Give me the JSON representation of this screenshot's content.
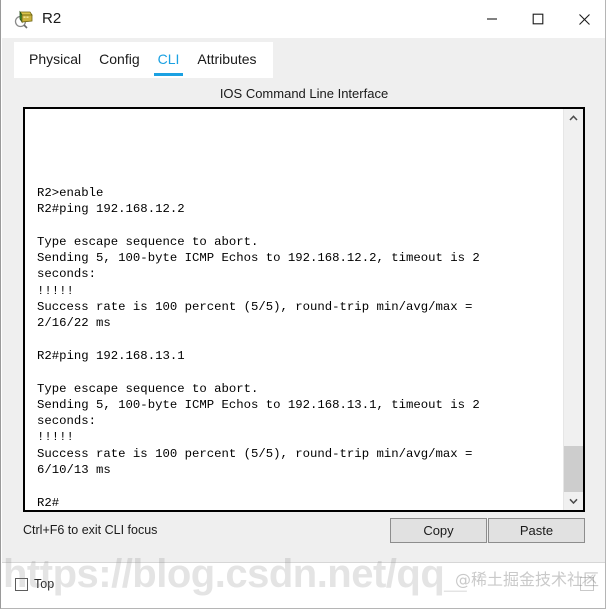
{
  "window": {
    "title": "R2",
    "icon": "router-device-icon",
    "controls": {
      "minimize_label": "─",
      "maximize_label": "□",
      "close_label": "✕"
    }
  },
  "tabs": [
    {
      "label": "Physical",
      "active": false
    },
    {
      "label": "Config",
      "active": false
    },
    {
      "label": "CLI",
      "active": true
    },
    {
      "label": "Attributes",
      "active": false
    }
  ],
  "panel": {
    "header": "IOS Command Line Interface"
  },
  "terminal": {
    "content": "R2>enable\nR2#ping 192.168.12.2\n\nType escape sequence to abort.\nSending 5, 100-byte ICMP Echos to 192.168.12.2, timeout is 2\nseconds:\n!!!!!\nSuccess rate is 100 percent (5/5), round-trip min/avg/max =\n2/16/22 ms\n\nR2#ping 192.168.13.1\n\nType escape sequence to abort.\nSending 5, 100-byte ICMP Echos to 192.168.13.1, timeout is 2\nseconds:\n!!!!!\nSuccess rate is 100 percent (5/5), round-trip min/avg/max =\n6/10/13 ms\n\nR2#"
  },
  "scrollbar": {
    "up_arrow": "scroll-up-icon",
    "down_arrow": "scroll-down-icon"
  },
  "footer": {
    "hint": "Ctrl+F6 to exit CLI focus",
    "copy_label": "Copy",
    "paste_label": "Paste"
  },
  "bottom": {
    "checkbox_label": "Top",
    "checkbox_checked": false
  },
  "watermarks": {
    "url": "https://blog.csdn.net/qq_",
    "brand": "@稀土掘金技术社区"
  },
  "colors": {
    "accent": "#1ba1e2",
    "panel_bg": "#efefef",
    "terminal_bg": "#ffffff",
    "terminal_fg": "#000000",
    "button_bg": "#e1e1e1"
  }
}
